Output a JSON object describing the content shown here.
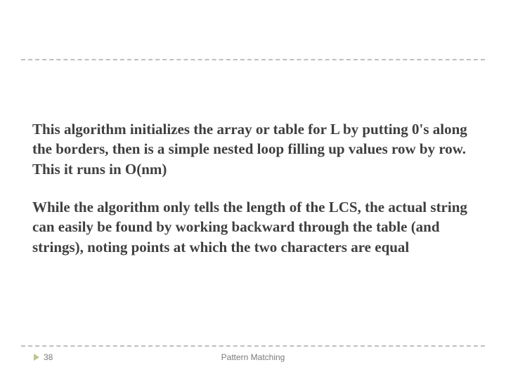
{
  "body": {
    "para1": "This algorithm initializes the array or table for L by putting 0's along the borders, then is a simple nested loop filling up values row by row.  This it runs in O(nm)",
    "para2": "While the algorithm only tells the length of the LCS, the actual string can easily be found by working backward through the table (and strings), noting points at which the two characters are equal"
  },
  "footer": {
    "page_number": "38",
    "title": "Pattern Matching"
  }
}
